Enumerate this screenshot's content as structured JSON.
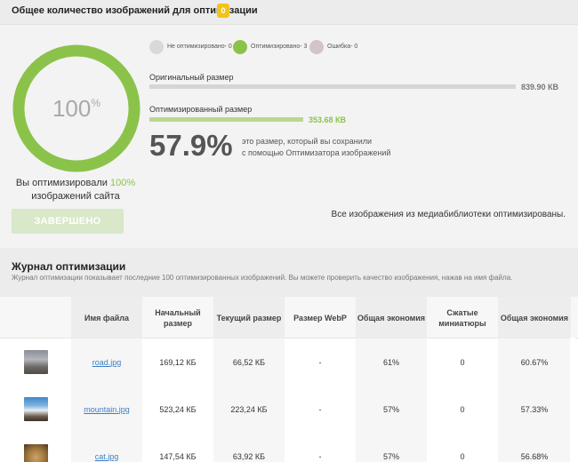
{
  "header": {
    "title": "Общее количество изображений для оптимизации",
    "badge": "0"
  },
  "summary": {
    "progress_percent": 100,
    "ring_value": "100",
    "ring_unit": "%",
    "optimized_prefix": "Вы оптимизировали",
    "optimized_value": "100%",
    "optimized_suffix": "изображений сайта",
    "done_button": "ЗАВЕРШЕНО",
    "legend": [
      {
        "label": "Не оптимизировано- 0",
        "color": "#d9d9d9"
      },
      {
        "label": "Оптимизировано- 3",
        "color": "#8bc34a"
      },
      {
        "label": "Ошибка- 0",
        "color": "#d3c5c5"
      }
    ],
    "original_label": "Оригинальный размер",
    "original_value": "839.90 КВ",
    "original_fraction": 1.0,
    "optimized_size_label": "Оптимизированный размер",
    "optimized_size_value": "353.68 КВ",
    "optimized_fraction": 0.421,
    "saved_percent": "57.9%",
    "saved_line1": "это размер, который вы сохранили",
    "saved_line2": "с помощью Оптимизатора изображений",
    "all_done": "Все изображения из медиабиблиотеки оптимизированы.",
    "colors": {
      "green": "#8bc34a",
      "grey_bar": "#d5d5d5",
      "light_green_bar": "#b7d98e"
    }
  },
  "journal": {
    "title": "Журнал оптимизации",
    "description": "Журнал оптимизации показывает последние 100 оптимизированных изображений. Вы можете проверить качество изображения, нажав на имя файла."
  },
  "table": {
    "headers": [
      "Имя файла",
      "Начальный размер",
      "Текущий размер",
      "Размер WebP",
      "Общая экономия",
      "Сжатые миниатюры",
      "Общая экономия"
    ],
    "rows": [
      {
        "thumb": "road-thumbnail",
        "file": "road.jpg",
        "initial": "169,12 КБ",
        "current": "66,52 КБ",
        "webp": "-",
        "saving": "61%",
        "thumbs": "0",
        "total": "60.67%"
      },
      {
        "thumb": "mountain-thumbnail",
        "file": "mountain.jpg",
        "initial": "523,24 КБ",
        "current": "223,24 КБ",
        "webp": "-",
        "saving": "57%",
        "thumbs": "0",
        "total": "57.33%"
      },
      {
        "thumb": "cat-thumbnail",
        "file": "cat.jpg",
        "initial": "147,54 КБ",
        "current": "63,92 КБ",
        "webp": "-",
        "saving": "57%",
        "thumbs": "0",
        "total": "56.68%"
      }
    ]
  }
}
